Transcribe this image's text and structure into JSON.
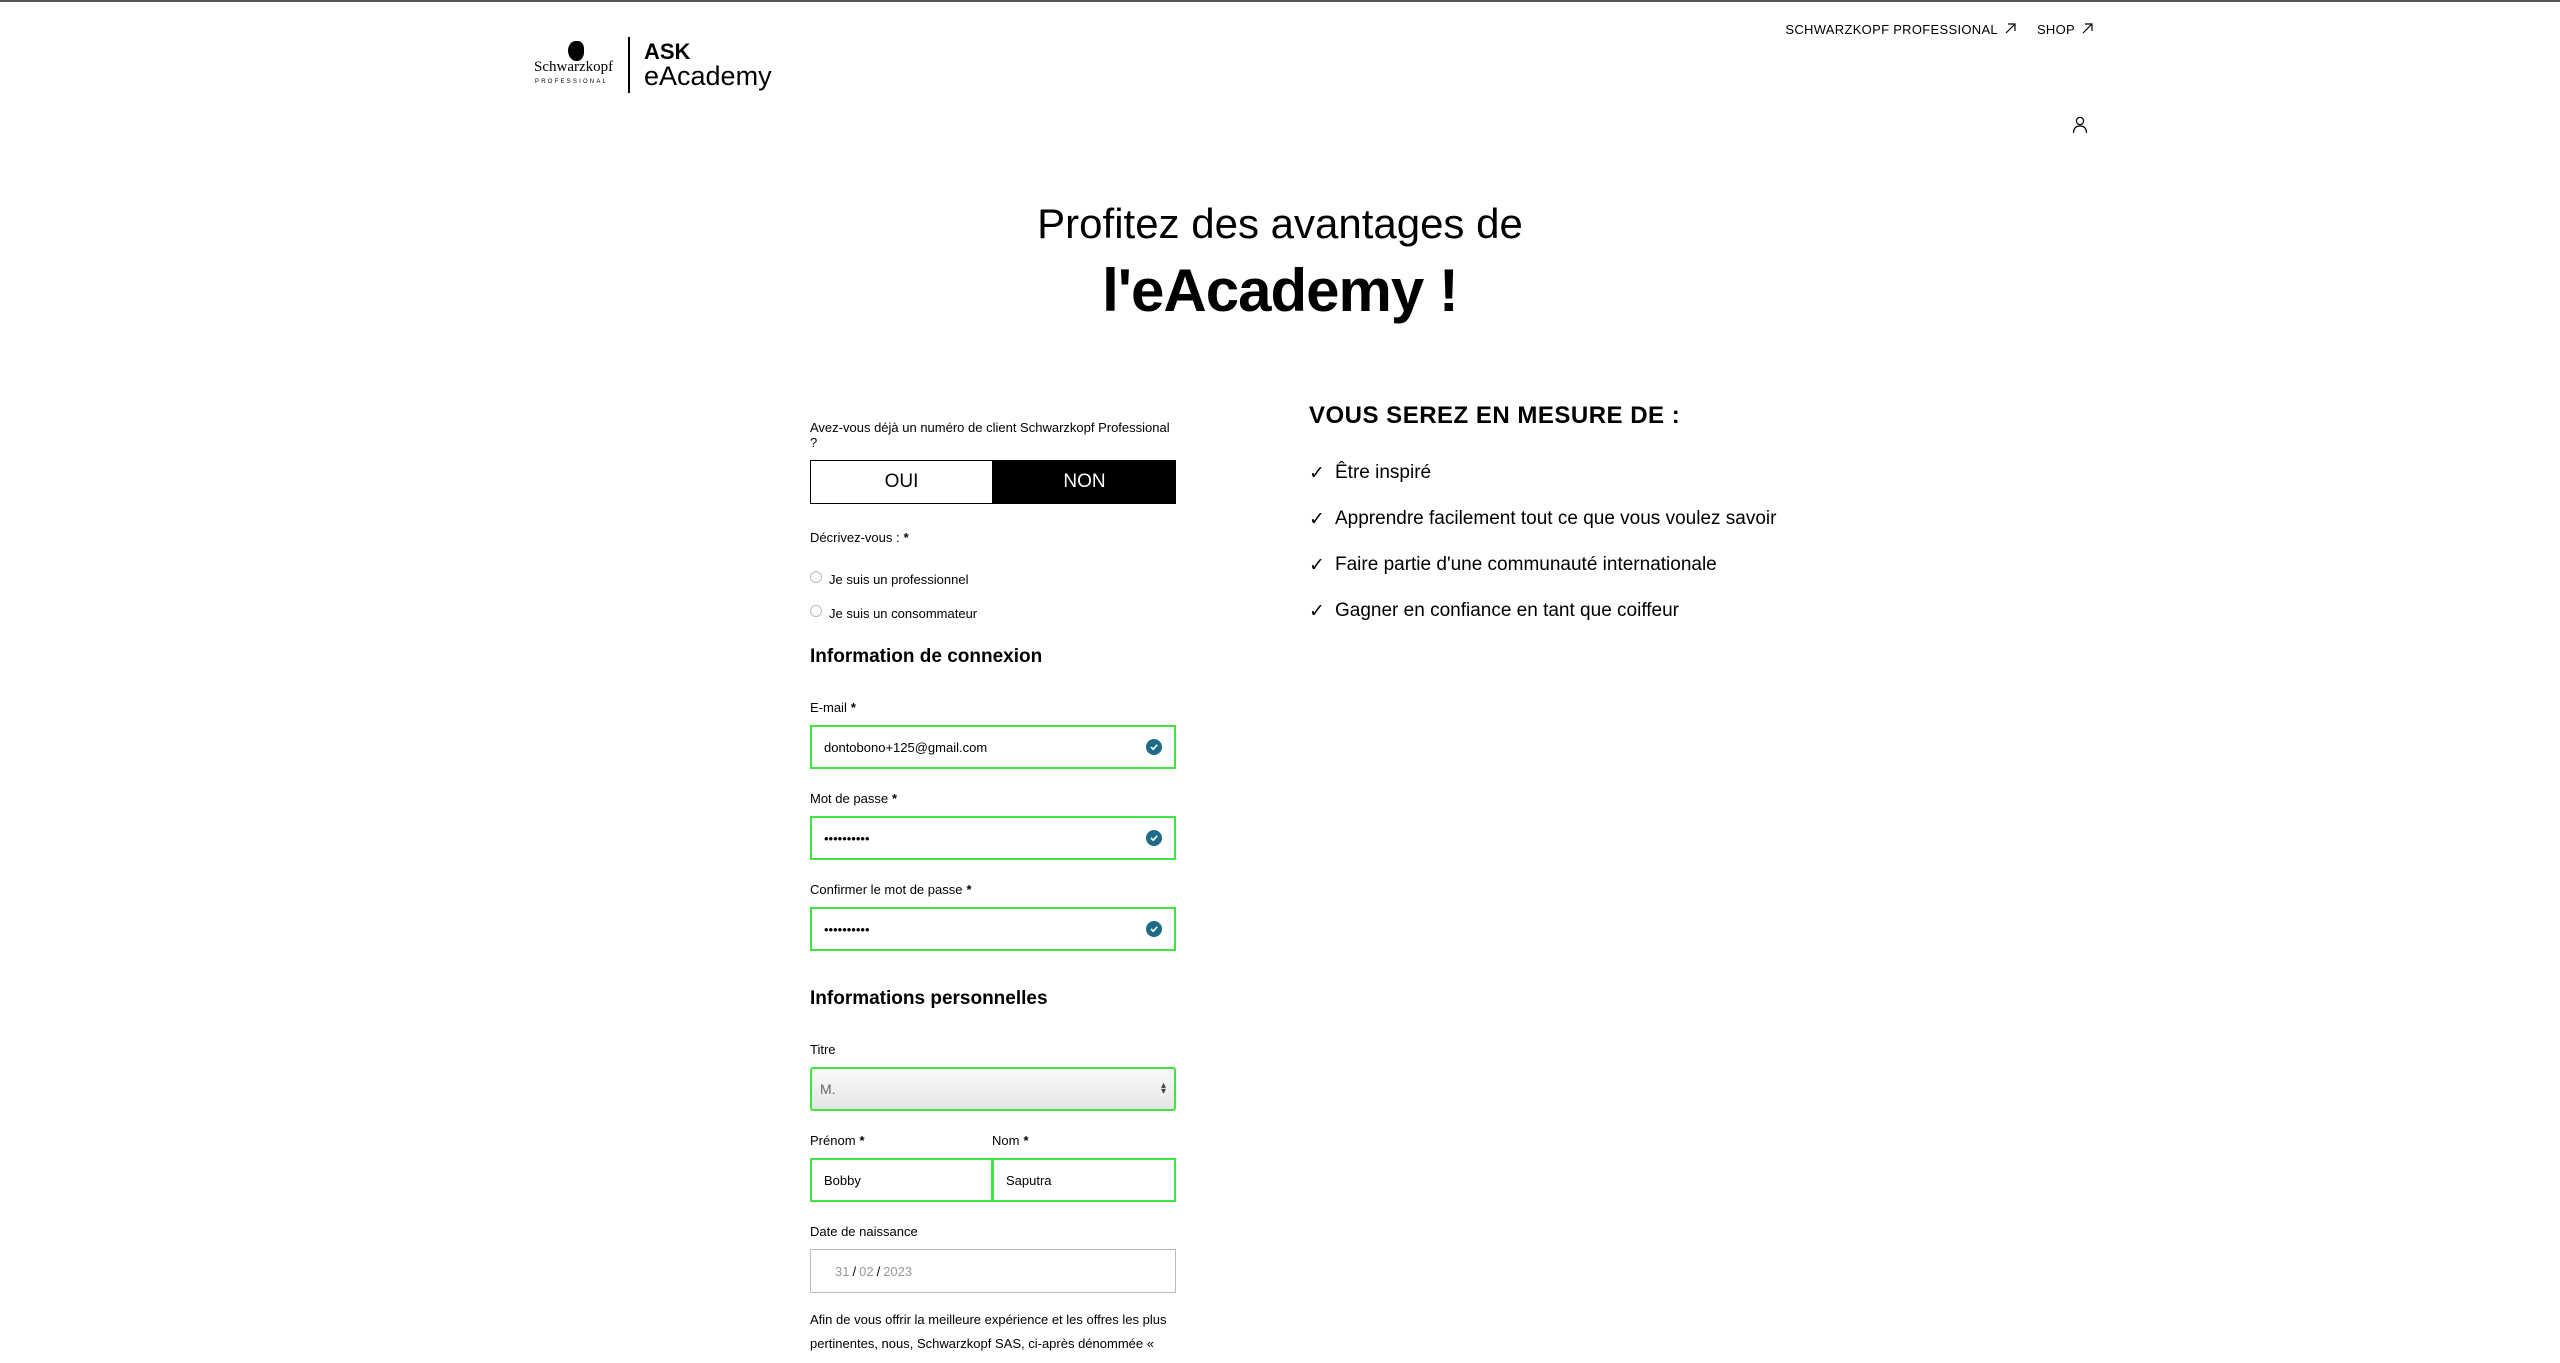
{
  "brand": {
    "sk_name": "Schwarzkopf",
    "sk_sub": "PROFESSIONAL",
    "ask": "ASK",
    "eacademy": "eAcademy"
  },
  "nav": {
    "pro_link": "SCHWARZKOPF PROFESSIONAL",
    "shop_link": "SHOP"
  },
  "hero": {
    "line1": "Profitez des avantages de",
    "line2": "l'eAcademy !"
  },
  "form": {
    "client_question": "Avez-vous déjà un numéro de client Schwarzkopf Professional ?",
    "toggle_yes": "OUI",
    "toggle_no": "NON",
    "describe_label": "Décrivez-vous :",
    "required_mark": "*",
    "radio_pro": "Je suis un professionnel",
    "radio_consumer": "Je suis un consommateur",
    "login_section": "Information de connexion",
    "email_label": "E-mail",
    "email_value": "dontobono+125@gmail.com",
    "password_label": "Mot de passe",
    "password_value": "••••••••••",
    "confirm_label": "Confirmer le mot de passe",
    "confirm_value": "••••••••••",
    "personal_section": "Informations personnelles",
    "title_label": "Titre",
    "title_value": "M.",
    "firstname_label": "Prénom",
    "firstname_value": "Bobby",
    "lastname_label": "Nom",
    "lastname_value": "Saputra",
    "birth_label": "Date de naissance",
    "birth_day": "31",
    "birth_month": "02",
    "birth_year": "2023",
    "privacy_text": "Afin de vous offrir la meilleure expérience et les offres les plus pertinentes, nous, Schwarzkopf SAS, ci-après dénommée «"
  },
  "benefits": {
    "title": "VOUS SEREZ EN MESURE DE :",
    "tick": "✓",
    "items": [
      "Être inspiré",
      "Apprendre facilement tout ce que vous voulez savoir",
      "Faire partie d'une communauté internationale",
      "Gagner en confiance en tant que coiffeur"
    ]
  },
  "colors": {
    "valid_border": "#41e341",
    "check_badge": "#1d6b87"
  }
}
